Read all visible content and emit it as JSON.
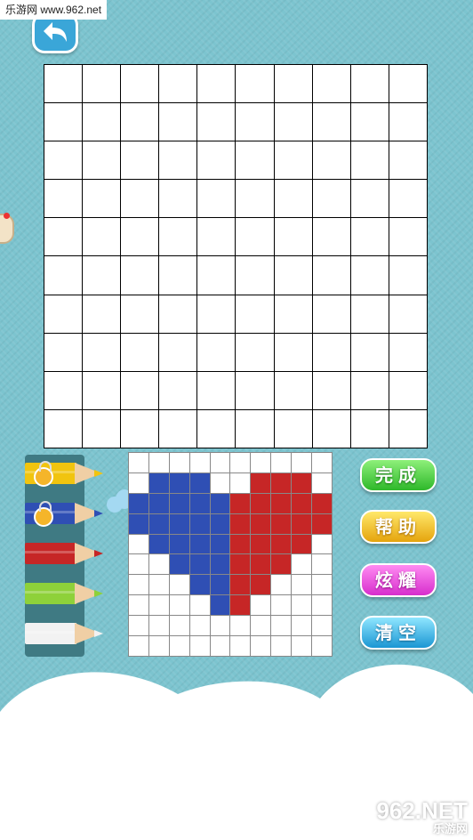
{
  "watermark_top": "乐游网 www.962.net",
  "watermark_bottom": {
    "brand": "962.NET",
    "sub": "乐游网"
  },
  "main_grid": {
    "rows": 10,
    "cols": 10
  },
  "preview_grid": {
    "rows": 10,
    "cols": 10,
    "cells": [
      "..........",
      ".BBB..RRR.",
      "BBBBBRRRRR",
      "BBBBBRRRRR",
      ".BBBBRRRR.",
      "..BBBRRR..",
      "...BBRR...",
      "....BR....",
      "..........",
      ".........."
    ],
    "colors": {
      "B": "#2f4fb4",
      "R": "#c62626"
    }
  },
  "pencils": [
    {
      "name": "yellow",
      "color": "#f1c40f",
      "locked": true
    },
    {
      "name": "blue",
      "color": "#2f4fb4",
      "locked": true
    },
    {
      "name": "red",
      "color": "#c62626",
      "locked": false
    },
    {
      "name": "green",
      "color": "#8ed13a",
      "locked": false
    },
    {
      "name": "white",
      "color": "#f2f2f2",
      "locked": false
    }
  ],
  "buttons": {
    "complete": "完成",
    "help": "帮助",
    "show_off": "炫耀",
    "clear": "清空"
  }
}
